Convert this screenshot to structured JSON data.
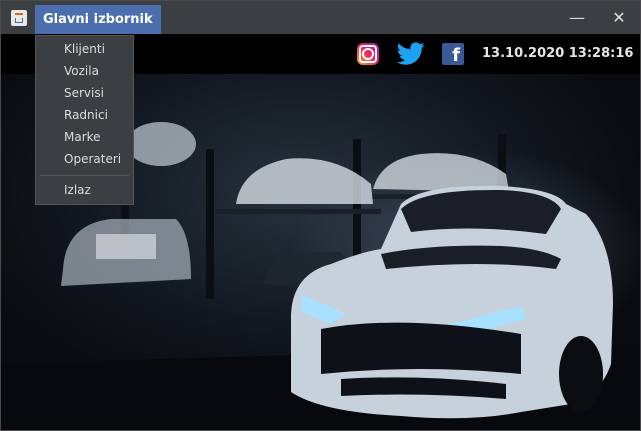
{
  "titlebar": {
    "menu_title": "Glavni izbornik",
    "app_icon": "java-cup-icon",
    "minimize_icon": "minimize-icon",
    "close_icon": "close-icon"
  },
  "menu": {
    "items": [
      {
        "label": "Klijenti"
      },
      {
        "label": "Vozila"
      },
      {
        "label": "Servisi"
      },
      {
        "label": "Radnici"
      },
      {
        "label": "Marke"
      },
      {
        "label": "Operateri"
      },
      {
        "label": "Izlaz"
      }
    ]
  },
  "header": {
    "social_icons": [
      "instagram-icon",
      "twitter-icon",
      "facebook-icon"
    ],
    "datetime": "13.10.2020 13:28:16"
  },
  "colors": {
    "menu_highlight": "#4b6eaf",
    "titlebar_bg": "#3c3f41",
    "menu_text": "#dcdcdc"
  }
}
